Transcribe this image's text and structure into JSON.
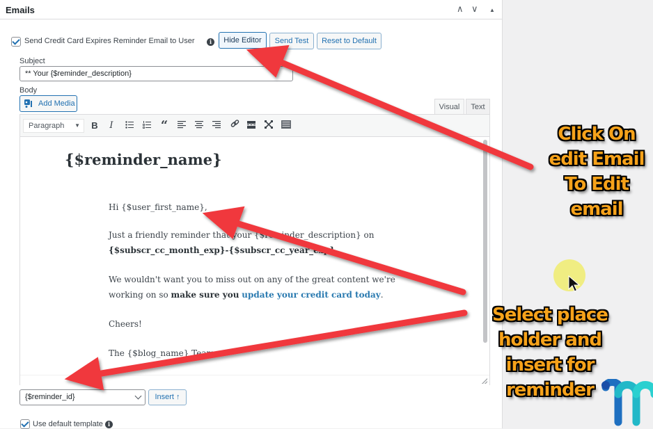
{
  "panel": {
    "title": "Emails",
    "header_controls": [
      {
        "name": "move-up",
        "glyph": "∧"
      },
      {
        "name": "move-down",
        "glyph": "∨"
      },
      {
        "name": "collapse",
        "glyph": "▲"
      }
    ]
  },
  "email_option": {
    "checkbox_label": "Send Credit Card Expires Reminder Email to User",
    "checked": true,
    "info_glyph": "i",
    "buttons": {
      "hide_editor": "Hide Editor",
      "send_test": "Send Test",
      "reset_default": "Reset to Default"
    }
  },
  "subject": {
    "label": "Subject",
    "value": "** Your {$reminder_description}"
  },
  "body": {
    "label": "Body",
    "add_media": "Add Media",
    "tabs": {
      "visual": "Visual",
      "text": "Text"
    },
    "active_tab": "Visual",
    "toolbar": {
      "format_select": "Paragraph",
      "buttons": [
        {
          "name": "bold",
          "glyph": "B"
        },
        {
          "name": "italic",
          "glyph": "I"
        },
        {
          "name": "bulleted-list",
          "glyph": "☰"
        },
        {
          "name": "numbered-list",
          "glyph": "☰"
        },
        {
          "name": "blockquote",
          "glyph": "“"
        },
        {
          "name": "align-left",
          "glyph": "≡"
        },
        {
          "name": "align-center",
          "glyph": "≡"
        },
        {
          "name": "align-right",
          "glyph": "≡"
        },
        {
          "name": "insert-link",
          "glyph": "🔗"
        },
        {
          "name": "read-more",
          "glyph": "═"
        },
        {
          "name": "fullscreen",
          "glyph": "✕"
        },
        {
          "name": "toolbar-toggle",
          "glyph": "▦"
        }
      ]
    },
    "content": {
      "heading": "{$reminder_name}",
      "greeting": "Hi {$user_first_name},",
      "p1_text": "Just a friendly reminder that your {$reminder_description} on",
      "p1_bold": "{$subscr_cc_month_exp}-{$subscr_cc_year_exp}",
      "p1_end": ".",
      "p2_text": "We wouldn't want you to miss out on any of the great content we're",
      "p2_text2": "working on so ",
      "p2_bold": "make sure you",
      "p2_link": "update your credit card today",
      "p2_end": ".",
      "p3": "Cheers!",
      "p4": "The {$blog_name} Team"
    }
  },
  "placeholder": {
    "selected": "{$reminder_id}",
    "insert_label": "Insert ↑"
  },
  "default_template": {
    "label": "Use default template",
    "checked": true
  },
  "annotations": {
    "caption_top": [
      "Click On",
      "edit Email",
      "To Edit",
      "email"
    ],
    "caption_bottom": [
      "Select place",
      "holder and",
      "insert for",
      "reminder"
    ],
    "arrow_color": "#f0393e",
    "caption_color": "#f6a21a"
  },
  "brand": {
    "primary": "#2271b1",
    "logo_colors": [
      "#1e6fc0",
      "#2ad0d0"
    ]
  }
}
